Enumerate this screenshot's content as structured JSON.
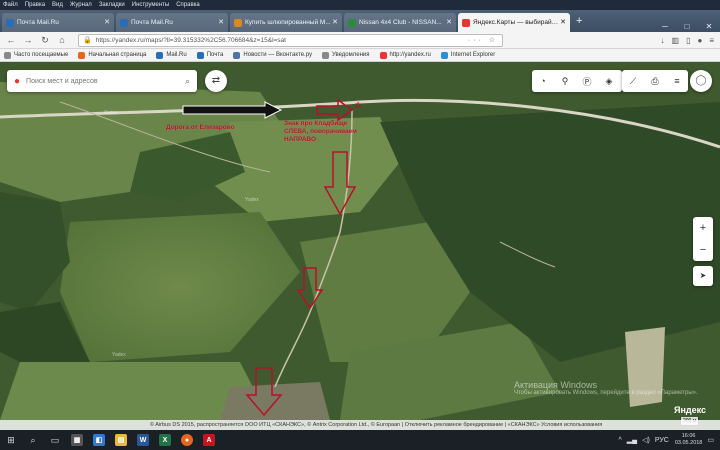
{
  "menubar": {
    "items": [
      "Файл",
      "Правка",
      "Вид",
      "Журнал",
      "Закладки",
      "Инструменты",
      "Справка"
    ]
  },
  "tabs": [
    {
      "title": "Почта Mail.Ru",
      "color": "#2a6db5"
    },
    {
      "title": "Почта Mail.Ru",
      "color": "#2a6db5"
    },
    {
      "title": "Купить шлюпированный М...",
      "color": "#d68a1f"
    },
    {
      "title": "Nissan 4x4 Club - NISSAN...",
      "color": "#2d8a3a"
    },
    {
      "title": "Яндекс.Карты — выбирайте...",
      "color": "#e33"
    }
  ],
  "nav": {
    "url": "https://yandex.ru/maps/?ll=39.315332%2C56.706684&z=15&l=sat"
  },
  "bookmarks": [
    {
      "label": "Часто посещаемые",
      "color": "#888"
    },
    {
      "label": "Начальная страница",
      "color": "#e8661c"
    },
    {
      "label": "Mail.Ru",
      "color": "#2a6db5"
    },
    {
      "label": "Почта",
      "color": "#2a6db5"
    },
    {
      "label": "Новости — Вконтакте.ру",
      "color": "#4c75a3"
    },
    {
      "label": "Уведомления",
      "color": "#888"
    },
    {
      "label": "http://yandex.ru",
      "color": "#e33"
    },
    {
      "label": "Internet Explorer",
      "color": "#2a8fd8"
    }
  ],
  "map": {
    "search_placeholder": "Поиск мест и адресов",
    "annotations": {
      "village": "Дорога от Елизарово",
      "turn_line1": "Знак про Кладбище",
      "turn_line2": "СЛЕВА, поворачиваем",
      "turn_line3": "НАПРАВО"
    },
    "labels": [
      "Yadex",
      "Yadex",
      "Yadex"
    ],
    "activation_title": "Активация Windows",
    "activation_text": "Чтобы активировать Windows, перейдите в раздел «Параметры».",
    "brand": "Яндекс",
    "scale": "200 м",
    "copyright": "© Airbus DS 2015, распространяется ООО ИТЦ «СКАНЭКС», © Antrix Corporation Ltd., © Europaan | Отключить рекламное брендирование | «СКАНЭКС» Условия использования"
  },
  "taskbar": {
    "lang": "РУС",
    "time": "16:06",
    "date": "03.05.2018"
  },
  "colors": {
    "annotation": "#b8102a",
    "arrow": "#b8102a"
  }
}
